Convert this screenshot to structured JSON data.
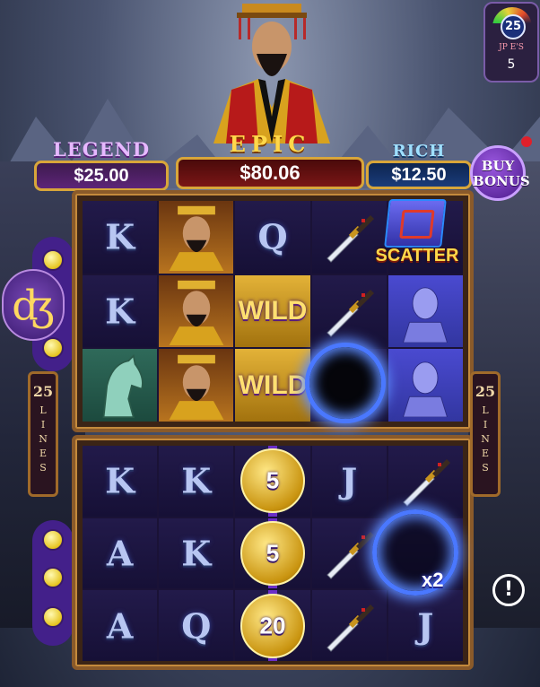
{
  "meter": {
    "value_top": "25",
    "label": "JP E'S",
    "value": "5"
  },
  "jackpots": {
    "legend": {
      "title": "LEGEND",
      "amount": "$25.00"
    },
    "epic": {
      "title": "EPIC",
      "amount": "$80.06"
    },
    "rich": {
      "title": "RICH",
      "amount": "$12.50"
    }
  },
  "buy_bonus": {
    "line1": "BUY",
    "line2": "BONUS"
  },
  "lines_left": {
    "count": "25",
    "word": [
      "L",
      "I",
      "N",
      "E",
      "S"
    ]
  },
  "lines_right": {
    "count": "25",
    "word": [
      "L",
      "I",
      "N",
      "E",
      "S"
    ]
  },
  "top_reels": [
    [
      "K",
      "emperor",
      "Q",
      "dagger",
      "scatter"
    ],
    [
      "K",
      "emperor",
      "WILD",
      "dagger",
      "statue"
    ],
    [
      "horse",
      "emperor",
      "WILD",
      "portal",
      "statue"
    ]
  ],
  "scatter_label": "SCATTER",
  "bottom_reels": [
    [
      "K",
      "K",
      "5",
      "J",
      "dagger"
    ],
    [
      "A",
      "K",
      "5",
      "dagger",
      "portal"
    ],
    [
      "A",
      "Q",
      "20",
      "dagger",
      "J"
    ]
  ],
  "multiplier": "x2",
  "info_icon": "!",
  "dragon_icon": "ʤ",
  "colors": {
    "accent": "#6a2ec8",
    "gold": "#d8a63a",
    "portal": "#4a78ff"
  }
}
